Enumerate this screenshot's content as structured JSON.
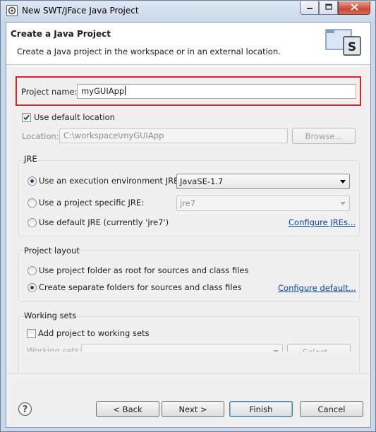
{
  "window": {
    "title": "New SWT/JFace Java Project"
  },
  "banner": {
    "title": "Create a Java Project",
    "description": "Create a Java project in the workspace or in an external location."
  },
  "project": {
    "name_label": "Project name:",
    "name_value": "myGUIApp"
  },
  "location": {
    "use_default_label": "Use default location",
    "use_default_checked": true,
    "label": "Location:",
    "value": "C:\\workspace\\myGUIApp",
    "browse_label": "Browse..."
  },
  "jre": {
    "group_title": "JRE",
    "options": [
      {
        "label": "Use an execution environment JRE:",
        "selected": true
      },
      {
        "label": "Use a project specific JRE:",
        "selected": false
      },
      {
        "label": "Use default JRE (currently 'jre7')",
        "selected": false
      }
    ],
    "env_value": "JavaSE-1.7",
    "specific_value": "jre7",
    "configure_link": "Configure JREs..."
  },
  "layout": {
    "group_title": "Project layout",
    "options": [
      {
        "label": "Use project folder as root for sources and class files",
        "selected": false
      },
      {
        "label": "Create separate folders for sources and class files",
        "selected": true
      }
    ],
    "configure_link": "Configure default..."
  },
  "working_sets": {
    "group_title": "Working sets",
    "add_label": "Add project to working sets",
    "add_checked": false,
    "sets_label": "Working sets:",
    "select_label": "Select..."
  },
  "footer": {
    "back": "< Back",
    "next": "Next >",
    "finish": "Finish",
    "cancel": "Cancel"
  },
  "icons": {
    "app": "window-icon",
    "minimize": "minimize-icon",
    "maximize": "maximize-icon",
    "close": "close-icon",
    "banner": "java-project-icon",
    "help": "help-icon"
  }
}
